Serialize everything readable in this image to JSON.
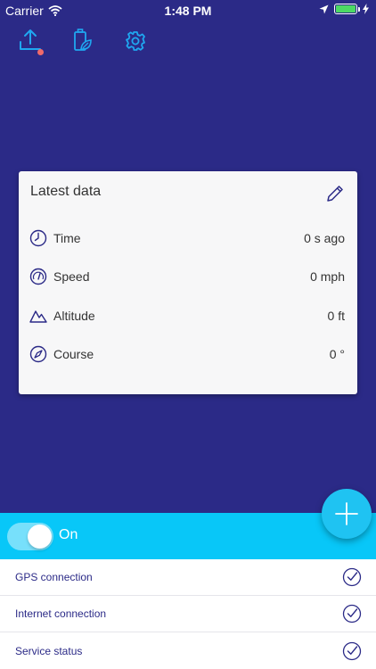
{
  "status_bar": {
    "carrier": "Carrier",
    "time": "1:48 PM"
  },
  "toolbar": {
    "icons": [
      "upload-icon",
      "battery-leaf-icon",
      "gear-icon"
    ],
    "accent": "#1fa7f0",
    "notification_color": "#f06a6a"
  },
  "card": {
    "title": "Latest data",
    "rows": [
      {
        "icon": "clock-icon",
        "label": "Time",
        "value": "0 s ago"
      },
      {
        "icon": "speedometer-icon",
        "label": "Speed",
        "value": "0 mph"
      },
      {
        "icon": "mountain-icon",
        "label": "Altitude",
        "value": "0 ft"
      },
      {
        "icon": "compass-icon",
        "label": "Course",
        "value": "0 °"
      }
    ]
  },
  "toggle": {
    "label": "On",
    "state": "on"
  },
  "status_list": [
    {
      "label": "GPS connection"
    },
    {
      "label": "Internet connection"
    },
    {
      "label": "Service status"
    }
  ],
  "colors": {
    "background": "#2b2a87",
    "toggle_bar": "#08c7f8",
    "fab": "#1fc3f2",
    "battery_fill": "#4cd964"
  }
}
